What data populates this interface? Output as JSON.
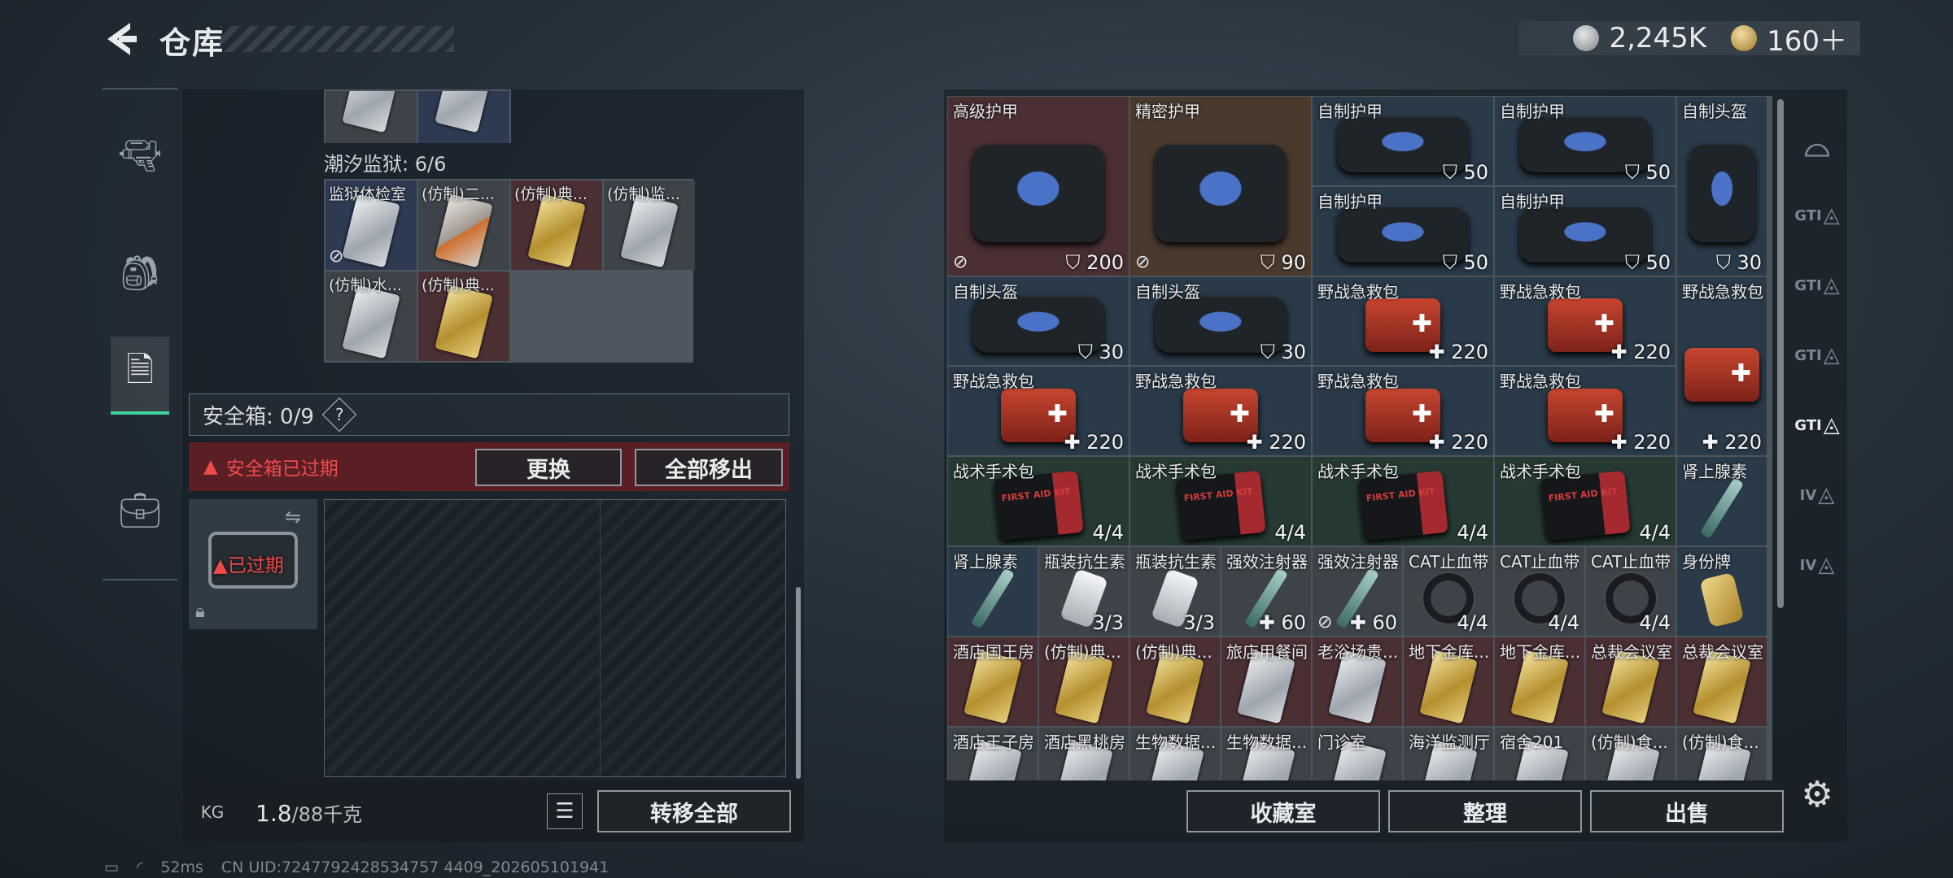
{
  "header": {
    "title": "仓库",
    "currency_silver": "2,245K",
    "currency_gold": "160＋"
  },
  "left_panel": {
    "section_label": "潮汐监狱: 6/6",
    "top_partial": [
      {
        "card": "silver"
      },
      {
        "card": "silver"
      }
    ],
    "keys": [
      {
        "name": "监狱体检室",
        "card": "silver",
        "bg": "blue",
        "no_trade": true
      },
      {
        "name": "(仿制)二...",
        "card": "orange",
        "bg": "gray"
      },
      {
        "name": "(仿制)典...",
        "card": "gold",
        "bg": "red"
      },
      {
        "name": "(仿制)监...",
        "card": "silver",
        "bg": "gray"
      },
      {
        "name": "(仿制)水...",
        "card": "silver",
        "bg": "gray"
      },
      {
        "name": "(仿制)典...",
        "card": "gold",
        "bg": "red"
      }
    ],
    "safe_box_label": "安全箱: 0/9",
    "help_mark": "?",
    "expired_banner": "安全箱已过期",
    "replace_button": "更换",
    "remove_all_button": "全部移出",
    "case_expired_text": "已过期",
    "weight_current": "1.8",
    "weight_max": "/88千克",
    "kg_label": "KG",
    "transfer_all_button": "转移全部"
  },
  "status_bar": {
    "ping": "52ms",
    "uid": "CN UID:7247792428534757 4409_202605101941"
  },
  "inventory": [
    {
      "name": "高级护甲",
      "kind": "armor",
      "bg": "red",
      "val": "200",
      "lock": true,
      "pos": [
        0,
        0,
        2,
        2
      ]
    },
    {
      "name": "精密护甲",
      "kind": "armor",
      "bg": "brown",
      "val": "90",
      "lock": true,
      "pos": [
        2,
        0,
        2,
        2
      ]
    },
    {
      "name": "自制护甲",
      "kind": "armor",
      "bg": "slate",
      "val": "50",
      "pos": [
        4,
        0,
        2,
        1
      ]
    },
    {
      "name": "自制护甲",
      "kind": "armor",
      "bg": "slate",
      "val": "50",
      "pos": [
        6,
        0,
        2,
        1
      ]
    },
    {
      "name": "自制头盔",
      "kind": "armor",
      "bg": "slate",
      "val": "30",
      "pos": [
        8,
        0,
        1,
        2
      ]
    },
    {
      "name": "自制护甲",
      "kind": "armor",
      "bg": "slate",
      "val": "50",
      "pos": [
        4,
        1,
        2,
        1
      ]
    },
    {
      "name": "自制护甲",
      "kind": "armor",
      "bg": "slate",
      "val": "50",
      "pos": [
        6,
        1,
        2,
        1
      ]
    },
    {
      "name": "自制头盔",
      "kind": "armor",
      "bg": "slate",
      "val": "30",
      "pos": [
        0,
        2,
        2,
        1
      ]
    },
    {
      "name": "自制头盔",
      "kind": "armor",
      "bg": "slate",
      "val": "30",
      "pos": [
        2,
        2,
        2,
        1
      ]
    },
    {
      "name": "野战急救包",
      "kind": "medkit",
      "bg": "slate",
      "val": "220",
      "plus": true,
      "pos": [
        4,
        2,
        2,
        1
      ]
    },
    {
      "name": "野战急救包",
      "kind": "medkit",
      "bg": "slate",
      "val": "220",
      "plus": true,
      "pos": [
        6,
        2,
        2,
        1
      ]
    },
    {
      "name": "野战急救包",
      "kind": "medkit",
      "bg": "slate",
      "val": "220",
      "plus": true,
      "pos": [
        8,
        2,
        1,
        2
      ]
    },
    {
      "name": "野战急救包",
      "kind": "medkit",
      "bg": "slate",
      "val": "220",
      "plus": true,
      "pos": [
        0,
        3,
        2,
        1
      ]
    },
    {
      "name": "野战急救包",
      "kind": "medkit",
      "bg": "slate",
      "val": "220",
      "plus": true,
      "pos": [
        2,
        3,
        2,
        1
      ]
    },
    {
      "name": "野战急救包",
      "kind": "medkit",
      "bg": "slate",
      "val": "220",
      "plus": true,
      "pos": [
        4,
        3,
        2,
        1
      ]
    },
    {
      "name": "野战急救包",
      "kind": "medkit",
      "bg": "slate",
      "val": "220",
      "plus": true,
      "pos": [
        6,
        3,
        2,
        1
      ]
    },
    {
      "name": "战术手术包",
      "kind": "ifak",
      "bg": "green",
      "val": "4/4",
      "pos": [
        0,
        4,
        2,
        1
      ]
    },
    {
      "name": "战术手术包",
      "kind": "ifak",
      "bg": "green",
      "val": "4/4",
      "pos": [
        2,
        4,
        2,
        1
      ]
    },
    {
      "name": "战术手术包",
      "kind": "ifak",
      "bg": "green",
      "val": "4/4",
      "pos": [
        4,
        4,
        2,
        1
      ]
    },
    {
      "name": "战术手术包",
      "kind": "ifak",
      "bg": "green",
      "val": "4/4",
      "pos": [
        6,
        4,
        2,
        1
      ]
    },
    {
      "name": "肾上腺素",
      "kind": "syringe",
      "bg": "slate",
      "val": "",
      "pos": [
        8,
        4,
        1,
        1
      ]
    },
    {
      "name": "肾上腺素",
      "kind": "syringe",
      "bg": "slate",
      "val": "",
      "pos": [
        0,
        5,
        1,
        1
      ]
    },
    {
      "name": "瓶装抗生素",
      "kind": "bottle",
      "bg": "gray",
      "val": "3/3",
      "pos": [
        1,
        5,
        1,
        1
      ]
    },
    {
      "name": "瓶装抗生素",
      "kind": "bottle",
      "bg": "gray",
      "val": "3/3",
      "pos": [
        2,
        5,
        1,
        1
      ]
    },
    {
      "name": "强效注射器",
      "kind": "syringe",
      "bg": "gray",
      "val": "60",
      "plus": true,
      "pos": [
        3,
        5,
        1,
        1
      ]
    },
    {
      "name": "强效注射器",
      "kind": "syringe",
      "bg": "gray",
      "val": "60",
      "plus": true,
      "lock": true,
      "pos": [
        4,
        5,
        1,
        1
      ]
    },
    {
      "name": "CAT止血带",
      "kind": "tourn",
      "bg": "gray",
      "val": "4/4",
      "pos": [
        5,
        5,
        1,
        1
      ]
    },
    {
      "name": "CAT止血带",
      "kind": "tourn",
      "bg": "gray",
      "val": "4/4",
      "pos": [
        6,
        5,
        1,
        1
      ]
    },
    {
      "name": "CAT止血带",
      "kind": "tourn",
      "bg": "gray",
      "val": "4/4",
      "pos": [
        7,
        5,
        1,
        1
      ]
    },
    {
      "name": "身份牌",
      "kind": "dogtag",
      "bg": "slate",
      "val": "",
      "pos": [
        8,
        5,
        1,
        1
      ]
    },
    {
      "name": "酒店国王房",
      "kind": "gold",
      "bg": "red",
      "val": "",
      "pos": [
        0,
        6,
        1,
        1
      ]
    },
    {
      "name": "(仿制)典...",
      "kind": "gold",
      "bg": "red",
      "val": "",
      "pos": [
        1,
        6,
        1,
        1
      ]
    },
    {
      "name": "(仿制)典...",
      "kind": "gold",
      "bg": "red",
      "val": "",
      "pos": [
        2,
        6,
        1,
        1
      ]
    },
    {
      "name": "旅店用餐间",
      "kind": "silver",
      "bg": "red",
      "val": "",
      "pos": [
        3,
        6,
        1,
        1
      ]
    },
    {
      "name": "老浴场贵...",
      "kind": "silver",
      "bg": "red",
      "val": "",
      "pos": [
        4,
        6,
        1,
        1
      ]
    },
    {
      "name": "地下金库...",
      "kind": "gold",
      "bg": "red",
      "val": "",
      "pos": [
        5,
        6,
        1,
        1
      ]
    },
    {
      "name": "地下金库...",
      "kind": "gold",
      "bg": "red",
      "val": "",
      "pos": [
        6,
        6,
        1,
        1
      ]
    },
    {
      "name": "总裁会议室",
      "kind": "gold",
      "bg": "red",
      "val": "",
      "pos": [
        7,
        6,
        1,
        1
      ]
    },
    {
      "name": "总裁会议室",
      "kind": "gold",
      "bg": "red",
      "val": "",
      "pos": [
        8,
        6,
        1,
        1
      ]
    },
    {
      "name": "酒店王子房",
      "kind": "silver",
      "bg": "gray",
      "val": "",
      "pos": [
        0,
        7,
        1,
        1
      ]
    },
    {
      "name": "酒店黑桃房",
      "kind": "silver",
      "bg": "gray",
      "val": "",
      "pos": [
        1,
        7,
        1,
        1
      ]
    },
    {
      "name": "生物数据...",
      "kind": "silver",
      "bg": "gray",
      "val": "",
      "pos": [
        2,
        7,
        1,
        1
      ]
    },
    {
      "name": "生物数据...",
      "kind": "silver",
      "bg": "gray",
      "val": "",
      "pos": [
        3,
        7,
        1,
        1
      ]
    },
    {
      "name": "门诊室",
      "kind": "silver",
      "bg": "gray",
      "val": "",
      "pos": [
        4,
        7,
        1,
        1
      ]
    },
    {
      "name": "海洋监测厅",
      "kind": "silver",
      "bg": "gray",
      "val": "",
      "pos": [
        5,
        7,
        1,
        1
      ]
    },
    {
      "name": "宿舍201",
      "kind": "silver",
      "bg": "gray",
      "val": "",
      "pos": [
        6,
        7,
        1,
        1
      ]
    },
    {
      "name": "(仿制)食...",
      "kind": "silver",
      "bg": "gray",
      "val": "",
      "pos": [
        7,
        7,
        1,
        1
      ]
    },
    {
      "name": "(仿制)食...",
      "kind": "silver",
      "bg": "gray",
      "val": "",
      "pos": [
        8,
        7,
        1,
        1
      ]
    }
  ],
  "bottom_buttons": {
    "collection": "收藏室",
    "sort": "整理",
    "sell": "出售"
  },
  "right_nav": [
    "",
    "GTI",
    "GTI",
    "GTI",
    "GTI",
    "IV",
    "IV"
  ]
}
